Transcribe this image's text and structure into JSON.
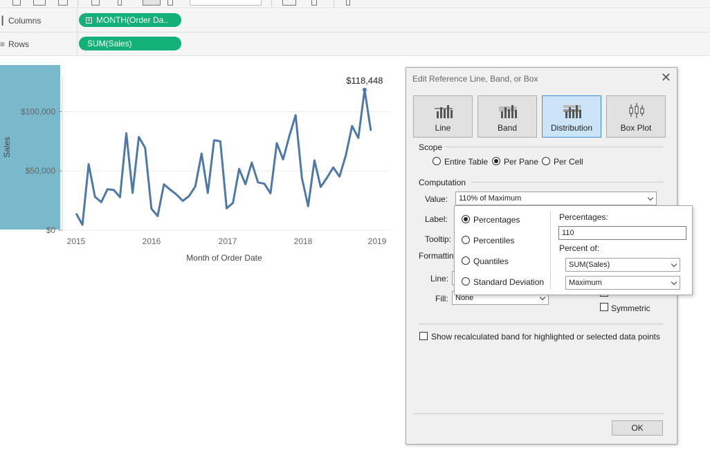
{
  "shelves": {
    "columns": {
      "label": "Columns",
      "pill": "MONTH(Order Da.."
    },
    "rows": {
      "label": "Rows",
      "pill": "SUM(Sales)"
    }
  },
  "chart_data": {
    "type": "line",
    "xlabel": "Month of Order Date",
    "ylabel": "Sales",
    "x_tick_labels": [
      "2015",
      "2016",
      "2017",
      "2018",
      "2019"
    ],
    "y_tick_labels": [
      "$0",
      "$50,000",
      "$100,000"
    ],
    "ylim": [
      0,
      130000
    ],
    "grid": true,
    "annotation": "$118,448",
    "series": [
      {
        "values": [
          14237,
          4520,
          55691,
          28295,
          23648,
          34595,
          33946,
          27909,
          81777,
          31453,
          78629,
          69546,
          18174,
          11951,
          38726,
          34195,
          30132,
          24797,
          28765,
          36898,
          64596,
          31405,
          75973,
          74919,
          18542,
          22978,
          51716,
          38750,
          56988,
          40344,
          39262,
          31115,
          73410,
          59688,
          79412,
          96999,
          43971,
          20301,
          58872,
          36522,
          44261,
          52981,
          45264,
          63121,
          87867,
          77777,
          118448,
          83829
        ]
      }
    ],
    "highlight_band_color": "#7ab8cc",
    "line_color": "#4e79a7"
  },
  "dialog": {
    "title": "Edit Reference Line, Band, or Box",
    "close_icon": "close-icon",
    "types": [
      {
        "label": "Line",
        "selected": false
      },
      {
        "label": "Band",
        "selected": false
      },
      {
        "label": "Distribution",
        "selected": true
      },
      {
        "label": "Box Plot",
        "selected": false
      }
    ],
    "scope": {
      "label": "Scope",
      "options": [
        "Entire Table",
        "Per Pane",
        "Per Cell"
      ],
      "selected": "Per Pane"
    },
    "computation": {
      "label": "Computation",
      "value_label": "Value:",
      "value": "110% of Maximum",
      "label_label": "Label:",
      "tooltip_label": "Tooltip:"
    },
    "formatting": {
      "label": "Formatting",
      "line_label": "Line:",
      "fill_label": "Fill:",
      "fill_value": "None",
      "symmetric": "Symmetric"
    },
    "show_recalculated": "Show recalculated band for highlighted or selected data points",
    "ok": "OK"
  },
  "popup": {
    "options": [
      "Percentages",
      "Percentiles",
      "Quantiles",
      "Standard Deviation"
    ],
    "selected": "Percentages",
    "percentages_label": "Percentages:",
    "percentages_value": "110",
    "percent_of_label": "Percent of:",
    "percent_of_measure": "SUM(Sales)",
    "percent_of_agg": "Maximum"
  }
}
